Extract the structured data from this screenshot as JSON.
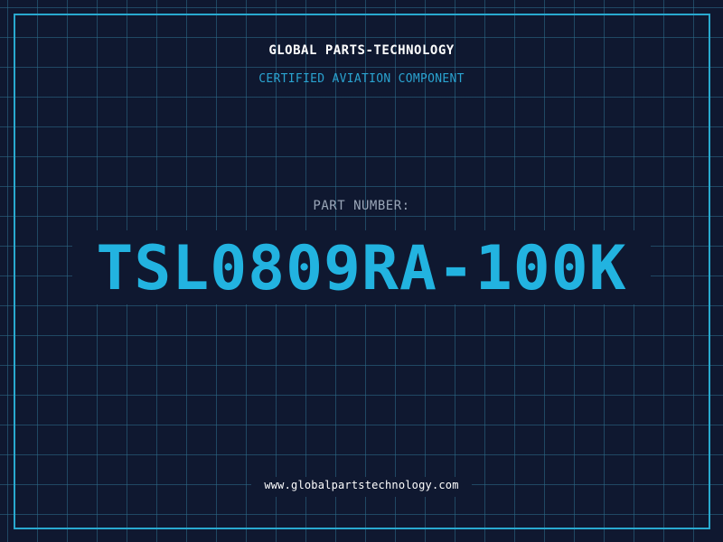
{
  "header": {
    "company": "GLOBAL PARTS-TECHNOLOGY",
    "tagline": "CERTIFIED AVIATION COMPONENT"
  },
  "part": {
    "label": "PART NUMBER:",
    "number": "TSL0809RA-100K"
  },
  "footer": {
    "url": "www.globalpartstechnology.com"
  },
  "colors": {
    "background": "#0f1830",
    "grid": "#2d6e8c",
    "accent": "#22b3e0",
    "frame": "#29a9cf"
  }
}
